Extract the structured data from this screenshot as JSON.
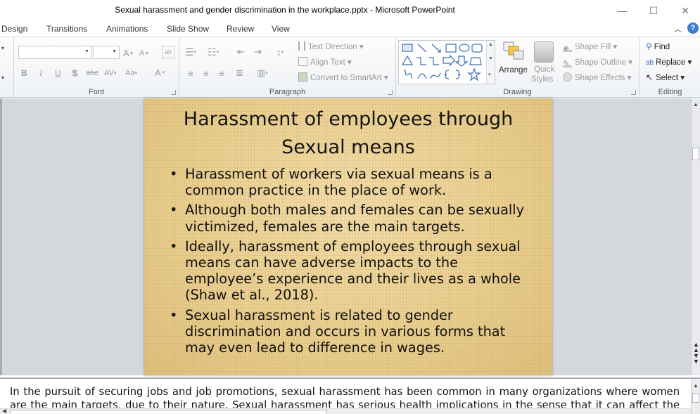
{
  "window": {
    "title": "Sexual harassment and gender discrimination in the workplace.pptx  -  Microsoft PowerPoint",
    "minimize": "—",
    "maximize": "☐",
    "close": "✕"
  },
  "tabs": [
    {
      "label": "Design"
    },
    {
      "label": "Transitions"
    },
    {
      "label": "Animations"
    },
    {
      "label": "Slide Show"
    },
    {
      "label": "Review"
    },
    {
      "label": "View"
    }
  ],
  "ribbon": {
    "font": {
      "label": "Font",
      "grow": "A",
      "shrink": "A",
      "bold": "B",
      "italic": "I",
      "underline": "U",
      "shadow": "S",
      "strike": "abc",
      "spacing": "AV",
      "case": "Aa",
      "color": "A"
    },
    "paragraph": {
      "label": "Paragraph",
      "text_direction": "Text Direction",
      "align_text": "Align Text",
      "convert_smartart": "Convert to SmartArt"
    },
    "drawing": {
      "label": "Drawing",
      "arrange": "Arrange",
      "quick_styles_1": "Quick",
      "quick_styles_2": "Styles",
      "shape_fill": "Shape Fill",
      "shape_outline": "Shape Outline",
      "shape_effects": "Shape Effects"
    },
    "editing": {
      "label": "Editing",
      "find": "Find",
      "replace": "Replace",
      "select": "Select"
    }
  },
  "slide": {
    "title_line1": "Harassment of employees through",
    "title_line2": "Sexual means",
    "bullets": [
      "Harassment of workers via sexual means is a common practice in the place of work.",
      "Although both males and females can be sexually victimized, females are the main targets.",
      "Ideally, harassment of employees through sexual means can have adverse impacts to the employee’s experience and their lives as a whole (Shaw et al., 2018).",
      "Sexual harassment is related to gender discrimination and occurs in various forms that may even lead to difference in wages."
    ]
  },
  "notes": {
    "text": "In the pursuit of securing jobs and job promotions, sexual harassment has been common in many organizations where women are the main targets, due to their nature. Sexual harassment has serious health implications in the sense that it can affect the mental and"
  }
}
